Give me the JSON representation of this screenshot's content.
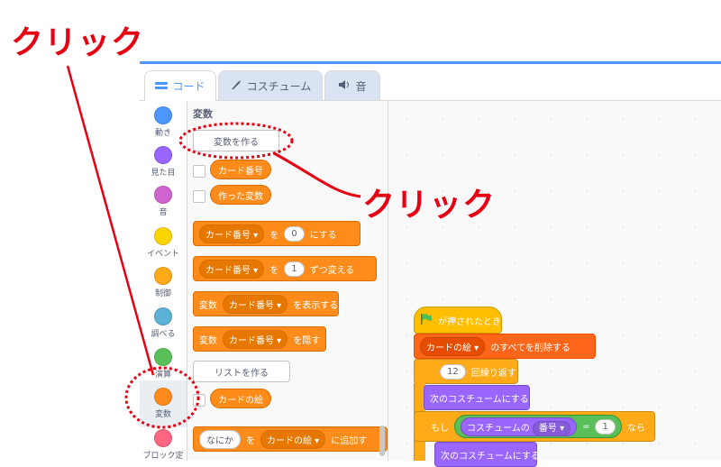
{
  "annotations": {
    "click_top": "クリック",
    "click_mid": "クリック"
  },
  "tabs": [
    {
      "label": "コード",
      "icon": "code-icon"
    },
    {
      "label": "コスチューム",
      "icon": "brush-icon"
    },
    {
      "label": "音",
      "icon": "speaker-icon"
    }
  ],
  "categories": [
    {
      "label": "動き",
      "color": "#4c97ff"
    },
    {
      "label": "見た目",
      "color": "#9966ff"
    },
    {
      "label": "音",
      "color": "#cf63cf"
    },
    {
      "label": "イベント",
      "color": "#ffd500"
    },
    {
      "label": "制御",
      "color": "#ffab19"
    },
    {
      "label": "調べる",
      "color": "#5cb1d6"
    },
    {
      "label": "演算",
      "color": "#59c059"
    },
    {
      "label": "変数",
      "color": "#ff8c1a"
    },
    {
      "label": "ブロック定",
      "color": "#ff6680"
    }
  ],
  "palette": {
    "section_title": "変数",
    "make_variable": "変数を作る",
    "var1": "カード番号",
    "var2": "作った変数",
    "set_block": {
      "var": "カード番号",
      "to": "を",
      "value": "0",
      "suffix": "にする"
    },
    "change_block": {
      "var": "カード番号",
      "by": "を",
      "value": "1",
      "suffix": "ずつ変える"
    },
    "show_block": {
      "prefix": "変数",
      "var": "カード番号",
      "suffix": "を表示する"
    },
    "hide_block": {
      "prefix": "変数",
      "var": "カード番号",
      "suffix": "を隠す"
    },
    "make_list": "リストを作る",
    "list1": "カードの絵",
    "add_block": {
      "item": "なにか",
      "to": "を",
      "list": "カードの絵",
      "suffix": "に追加す"
    }
  },
  "script": {
    "hat": "が押されたとき",
    "delete_all": {
      "list": "カードの絵",
      "suffix": "のすべてを削除する"
    },
    "repeat": {
      "count": "12",
      "label": "回繰り返す"
    },
    "next_costume": "次のコスチュームにする",
    "if": {
      "prefix": "もし",
      "reporter": "コスチュームの",
      "dropdown": "番号",
      "op": "=",
      "value": "1",
      "suffix": "なら"
    },
    "next_costume2": "次のコスチュームにする"
  },
  "colors": {
    "annotation_red": "#e60012",
    "scratch_blue": "#4c97ff",
    "variables_orange": "#ff8c1a"
  }
}
